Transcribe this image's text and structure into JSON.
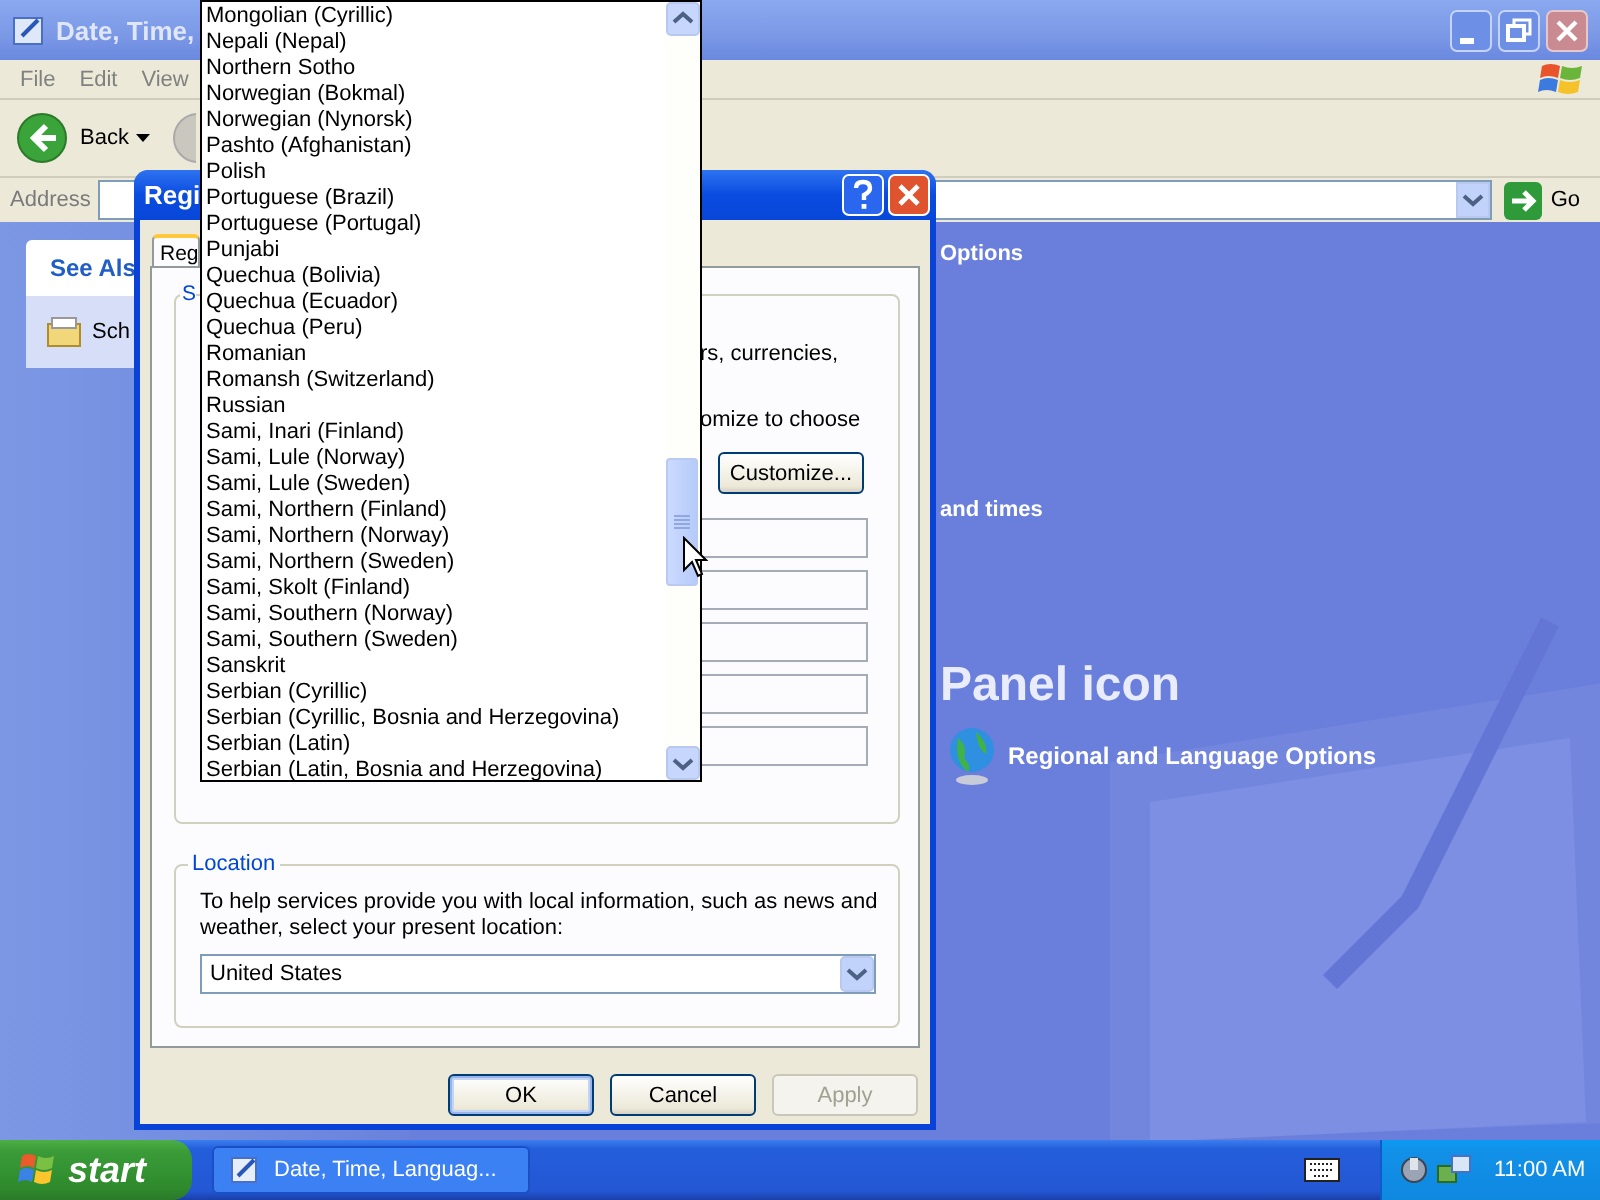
{
  "explorer": {
    "title": "Date, Time,",
    "menu": [
      "File",
      "Edit",
      "View"
    ],
    "back": "Back",
    "address_label": "Address",
    "go": "Go",
    "see_also": "See Als",
    "see_also_items": [
      "Sch"
    ],
    "content": {
      "heading": "Options",
      "task": "and times",
      "panel_heading": "Panel icon",
      "panel_items": [
        "Regional and Language Options"
      ]
    }
  },
  "dialog": {
    "title": "Regi",
    "tab": "Reg",
    "group": "S",
    "text_1": "rs, currencies,",
    "text_2": "omize to choose",
    "customize": "Customize...",
    "location": {
      "label": "Location",
      "text": "To help services provide you with local information, such as news and weather, select your present location:",
      "value": "United States"
    },
    "buttons": [
      {
        "label": "OK",
        "disabled": false
      },
      {
        "label": "Cancel",
        "disabled": false
      },
      {
        "label": "Apply",
        "disabled": true
      }
    ]
  },
  "language_list": {
    "items": [
      {
        "label": "Mongolian (Cyrillic)",
        "selected": false
      },
      {
        "label": "Nepali (Nepal)",
        "selected": false
      },
      {
        "label": "Northern Sotho",
        "selected": false
      },
      {
        "label": "Norwegian (Bokmal)",
        "selected": false
      },
      {
        "label": "Norwegian (Nynorsk)",
        "selected": false
      },
      {
        "label": "Pashto (Afghanistan)",
        "selected": false
      },
      {
        "label": "Polish",
        "selected": false
      },
      {
        "label": "Portuguese (Brazil)",
        "selected": false
      },
      {
        "label": "Portuguese (Portugal)",
        "selected": false
      },
      {
        "label": "Punjabi",
        "selected": false
      },
      {
        "label": "Quechua (Bolivia)",
        "selected": false
      },
      {
        "label": "Quechua (Ecuador)",
        "selected": false
      },
      {
        "label": "Quechua (Peru)",
        "selected": false
      },
      {
        "label": "Romanian",
        "selected": false
      },
      {
        "label": "Romansh (Switzerland)",
        "selected": false
      },
      {
        "label": "Russian",
        "selected": false
      },
      {
        "label": "Sami, Inari (Finland)",
        "selected": false
      },
      {
        "label": "Sami, Lule (Norway)",
        "selected": false
      },
      {
        "label": "Sami, Lule (Sweden)",
        "selected": false
      },
      {
        "label": "Sami, Northern (Finland)",
        "selected": false
      },
      {
        "label": "Sami, Northern (Norway)",
        "selected": false
      },
      {
        "label": "Sami, Northern (Sweden)",
        "selected": false
      },
      {
        "label": "Sami, Skolt (Finland)",
        "selected": false
      },
      {
        "label": "Sami, Southern (Norway)",
        "selected": false
      },
      {
        "label": "Sami, Southern (Sweden)",
        "selected": false
      },
      {
        "label": "Sanskrit",
        "selected": false
      },
      {
        "label": "Serbian (Cyrillic)",
        "selected": false
      },
      {
        "label": "Serbian (Cyrillic, Bosnia and Herzegovina)",
        "selected": false
      },
      {
        "label": "Serbian (Latin)",
        "selected": false
      },
      {
        "label": "Serbian (Latin, Bosnia and Herzegovina)",
        "selected": false
      }
    ]
  },
  "taskbar": {
    "start": "start",
    "tasks": [
      {
        "label": "Date, Time, Languag...",
        "selected": false
      }
    ],
    "clock": "11:00 AM"
  }
}
